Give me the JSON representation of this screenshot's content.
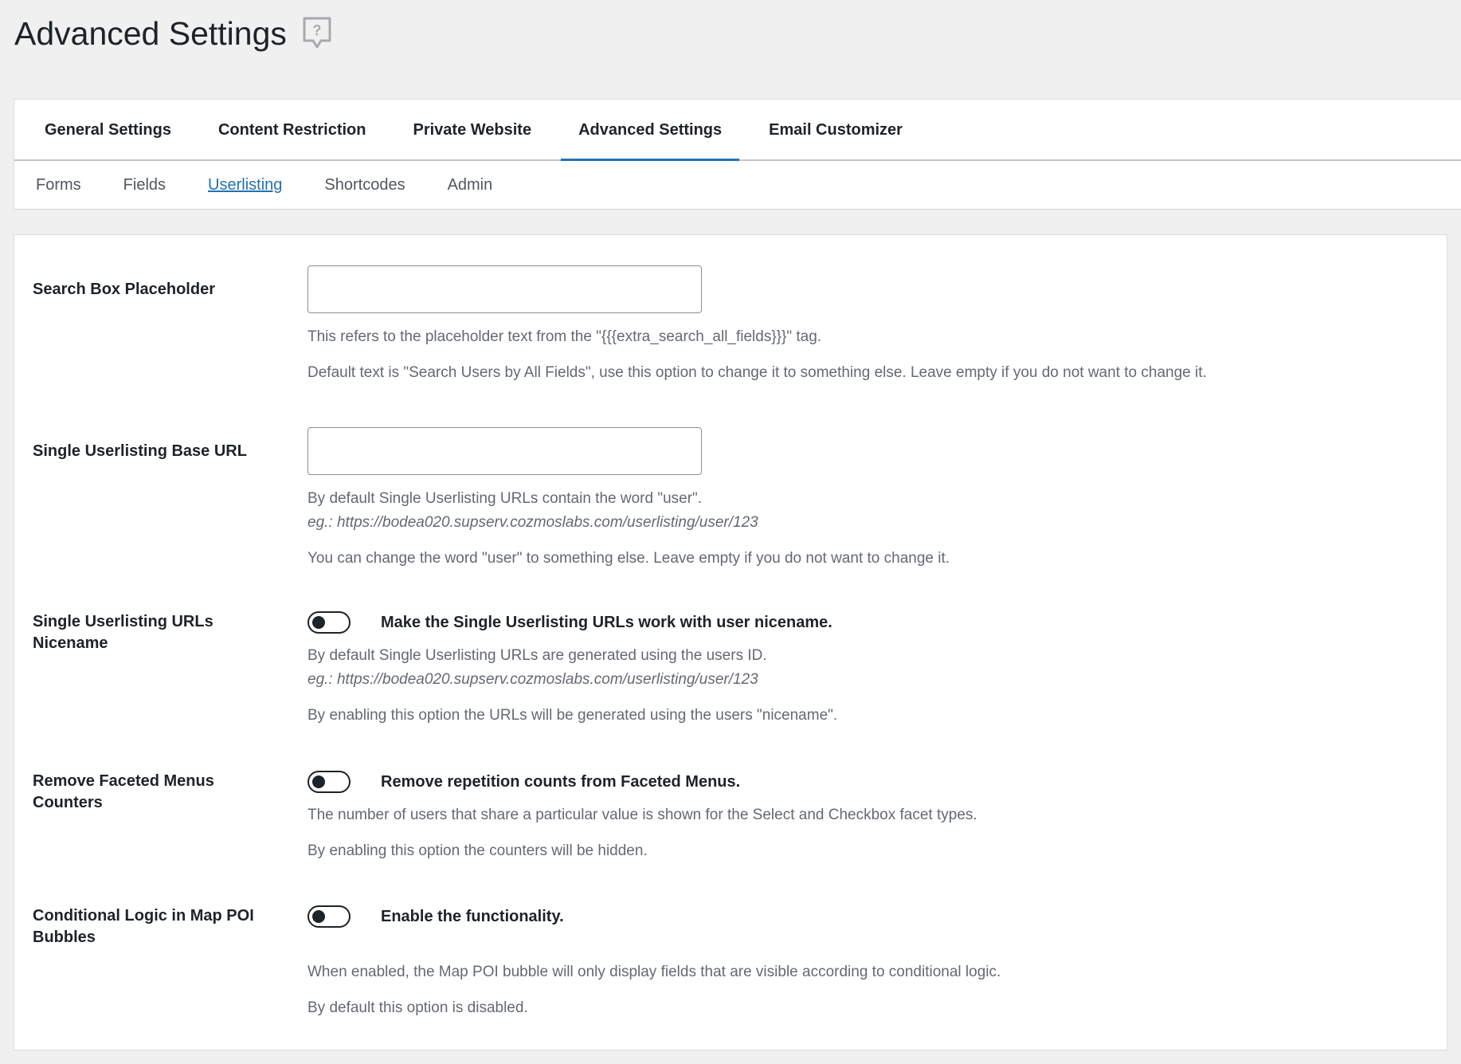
{
  "page": {
    "title": "Advanced Settings",
    "help_icon": "help-question-bubble-icon"
  },
  "main_tabs": [
    {
      "label": "General Settings",
      "active": false
    },
    {
      "label": "Content Restriction",
      "active": false
    },
    {
      "label": "Private Website",
      "active": false
    },
    {
      "label": "Advanced Settings",
      "active": true
    },
    {
      "label": "Email Customizer",
      "active": false
    }
  ],
  "sub_tabs": [
    {
      "label": "Forms",
      "active": false
    },
    {
      "label": "Fields",
      "active": false
    },
    {
      "label": "Userlisting",
      "active": true
    },
    {
      "label": "Shortcodes",
      "active": false
    },
    {
      "label": "Admin",
      "active": false
    }
  ],
  "settings": {
    "search_box_placeholder": {
      "label": "Search Box Placeholder",
      "value": "",
      "desc1": "This refers to the placeholder text from the \"{{{extra_search_all_fields}}}\" tag.",
      "desc2": "Default text is \"Search Users by All Fields\", use this option to change it to something else. Leave empty if you do not want to change it."
    },
    "base_url": {
      "label": "Single Userlisting Base URL",
      "value": "",
      "desc1": "By default Single Userlisting URLs contain the word \"user\".",
      "example": "eg.: https://bodea020.supserv.cozmoslabs.com/userlisting/user/123",
      "desc2": "You can change the word \"user\" to something else. Leave empty if you do not want to change it."
    },
    "nicename": {
      "label": "Single Userlisting URLs Nicename",
      "enabled": false,
      "toggle_label": "Make the Single Userlisting URLs work with user nicename.",
      "desc1": "By default Single Userlisting URLs are generated using the users ID.",
      "example": "eg.: https://bodea020.supserv.cozmoslabs.com/userlisting/user/123",
      "desc2": "By enabling this option the URLs will be generated using the users \"nicename\"."
    },
    "faceted_counters": {
      "label": "Remove Faceted Menus Counters",
      "enabled": false,
      "toggle_label": "Remove repetition counts from Faceted Menus.",
      "desc1": "The number of users that share a particular value is shown for the Select and Checkbox facet types.",
      "desc2": "By enabling this option the counters will be hidden."
    },
    "map_poi": {
      "label_line1": "Conditional Logic in Map POI",
      "label_line2": "Bubbles",
      "enabled": false,
      "toggle_label": "Enable the functionality.",
      "desc1": "When enabled, the Map POI bubble will only display fields that are visible according to conditional logic.",
      "desc2": "By default this option is disabled."
    }
  }
}
